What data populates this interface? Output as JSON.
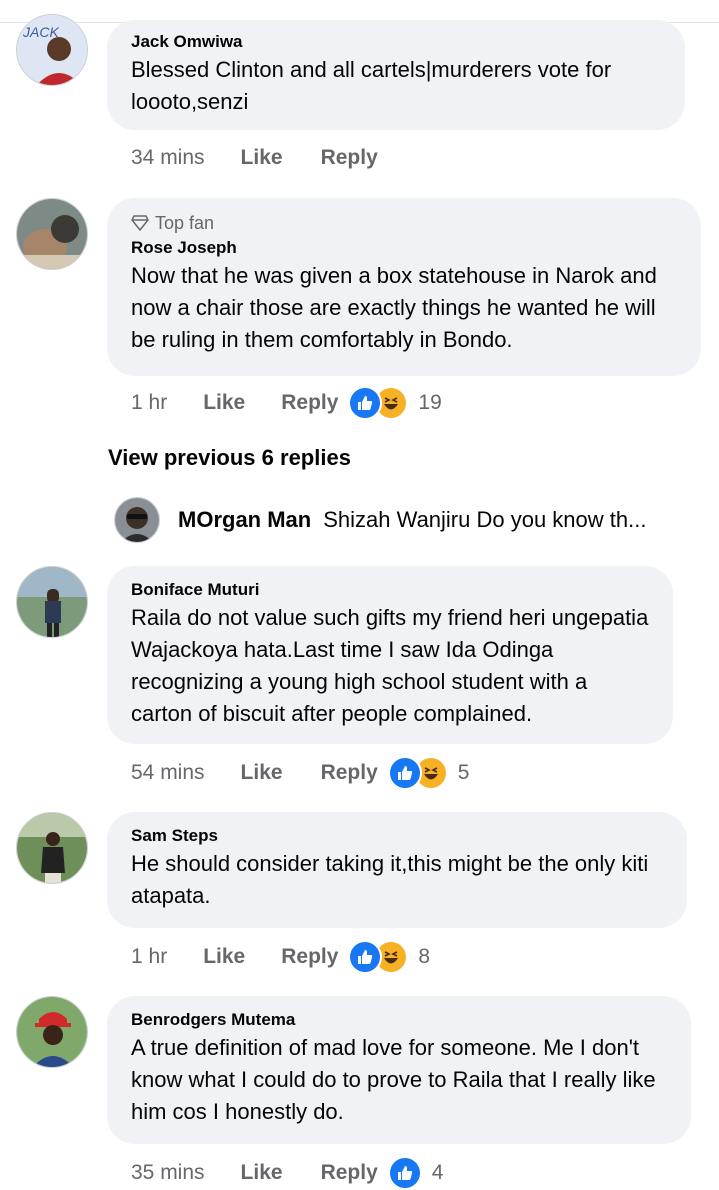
{
  "comments": [
    {
      "author": "Jack Omwiwa",
      "text": "Blessed Clinton and all cartels|murderers vote for loooto,senzi",
      "time": "34 mins",
      "like": "Like",
      "reply": "Reply",
      "avatar_text": "JACK"
    },
    {
      "badge": "Top fan",
      "author": "Rose Joseph",
      "text": "Now that he was  given a box statehouse in Narok and now a chair those are exactly things he wanted he will be ruling in them comfortably in Bondo.",
      "time": "1 hr",
      "like": "Like",
      "reply": "Reply",
      "reactions": [
        "like",
        "haha"
      ],
      "count": "19"
    },
    {
      "author": "Boniface Muturi",
      "text": "Raila do not value such gifts my friend heri ungepatia Wajackoya hata.Last time I saw Ida Odinga recognizing a young high school student with a carton of biscuit after people complained.",
      "time": "54 mins",
      "like": "Like",
      "reply": "Reply",
      "reactions": [
        "like",
        "haha"
      ],
      "count": "5"
    },
    {
      "author": "Sam Steps",
      "text": "He should consider taking it,this might be the only kiti atapata.",
      "time": "1 hr",
      "like": "Like",
      "reply": "Reply",
      "reactions": [
        "like",
        "haha"
      ],
      "count": "8"
    },
    {
      "author": "Benrodgers Mutema",
      "text": "A true definition of mad love for someone. Me I don't know what I could do to prove to Raila that  I really like him cos I honestly do.",
      "time": "35 mins",
      "like": "Like",
      "reply": "Reply",
      "reactions": [
        "like"
      ],
      "count": "4"
    }
  ],
  "view_previous": "View previous 6 replies",
  "reply_preview": {
    "author": "MOrgan Man",
    "snippet": "Shizah Wanjiru Do you know th..."
  },
  "colors": {
    "bubble": "#f0f2f5",
    "meta": "#65676b",
    "like_blue": "#1877f2",
    "haha_yellow": "#f7b125"
  }
}
